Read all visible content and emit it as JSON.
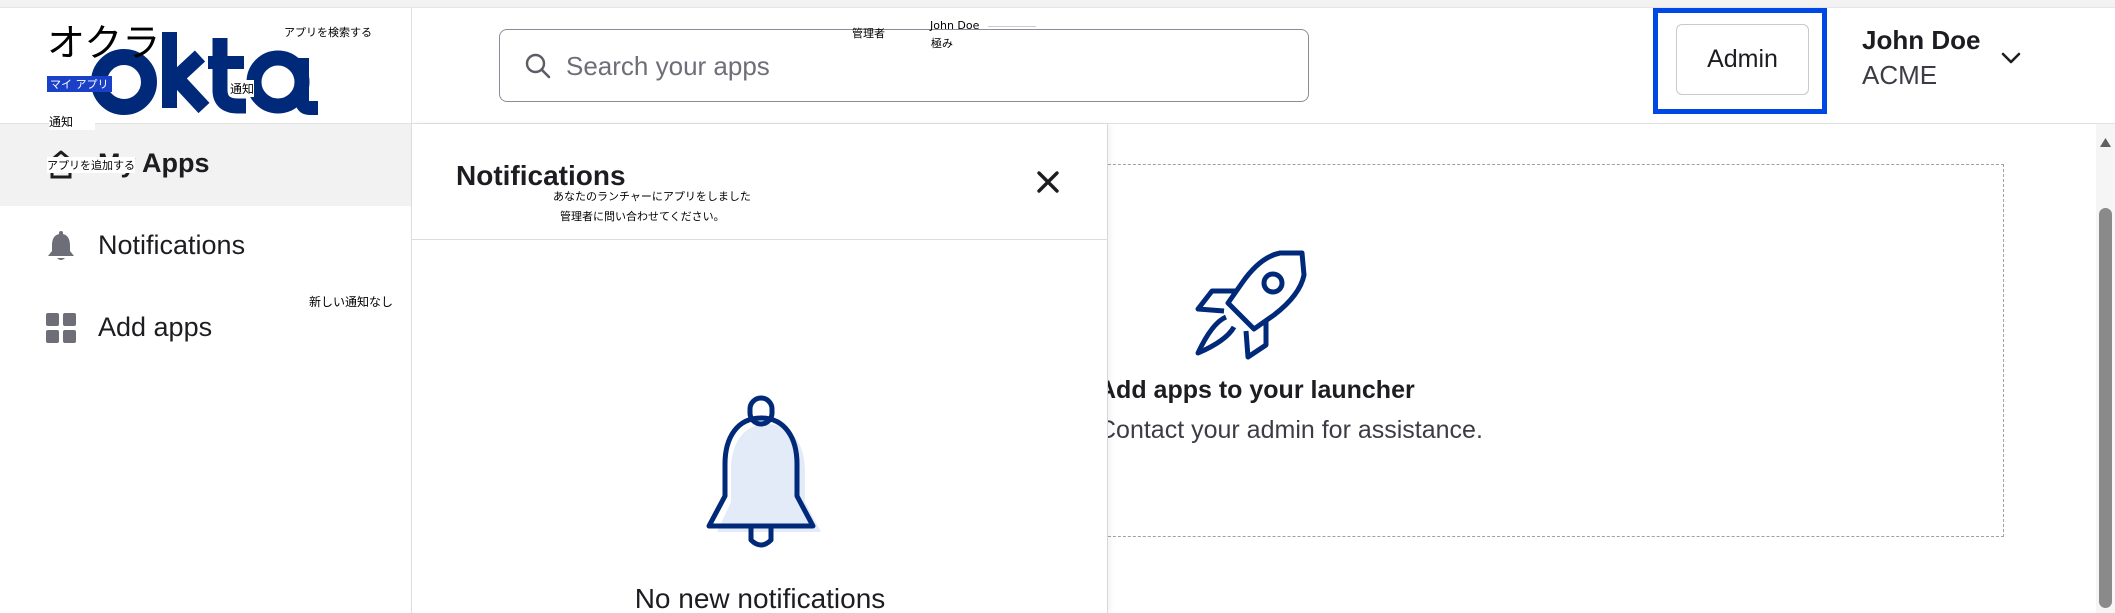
{
  "header": {
    "logo_text": "okta",
    "search": {
      "placeholder": "Search your apps"
    },
    "admin_button": "Admin",
    "user": {
      "name": "John Doe",
      "org": "ACME"
    }
  },
  "sidebar": {
    "items": [
      {
        "label": "My Apps",
        "icon": "home-icon",
        "active": true
      },
      {
        "label": "Notifications",
        "icon": "bell-icon",
        "active": false
      },
      {
        "label": "Add apps",
        "icon": "grid-icon",
        "active": false
      }
    ]
  },
  "notifications_panel": {
    "title": "Notifications",
    "empty_text": "No new notifications"
  },
  "main": {
    "empty_title": "Add apps to your launcher",
    "empty_subtitle": "Contact your admin for assistance."
  },
  "overlay_labels": {
    "okra": "オクラ",
    "search_apps": "アプリを検索する",
    "admin": "管理者",
    "john_doe": "John Doe",
    "kiwami": "極み",
    "my_apps": "マイ アプリ",
    "notifications_1": "通知",
    "notifications_2": "通知",
    "add_apps": "アプリを追加する",
    "launcher": "あなたのランチャーにアプリをしました",
    "contact_admin": "管理者に問い合わせてください。",
    "no_new_notifications": "新しい通知なし"
  },
  "colors": {
    "okta_blue": "#00297a",
    "highlight_blue": "#0048e5",
    "icon_gray": "#6e6e78",
    "active_bg": "#f2f2f3"
  }
}
